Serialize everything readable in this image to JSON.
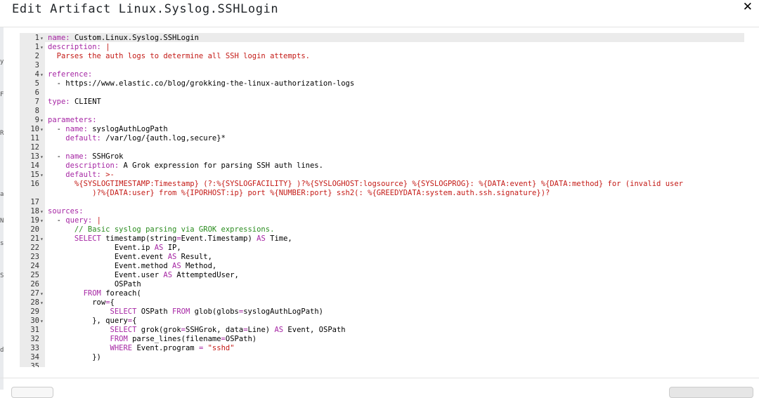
{
  "dialog": {
    "title": "Edit Artifact Linux.Syslog.SSHLogin",
    "close_icon": "✕"
  },
  "background_edge": [
    "y",
    "F",
    "R",
    "a",
    "N",
    "s",
    "S",
    "d"
  ],
  "editor": {
    "lines": [
      {
        "n": "1",
        "fold": "▾",
        "t": [
          [
            "k",
            "name: "
          ],
          [
            "p",
            "Custom.Linux.Syslog.SSHLogin"
          ]
        ]
      },
      {
        "n": "1",
        "fold": "▾",
        "t": [
          [
            "k",
            "description: "
          ],
          [
            "s",
            "|"
          ]
        ]
      },
      {
        "n": "2",
        "fold": "",
        "t": [
          [
            "s",
            "  Parses the auth logs to determine all SSH login attempts."
          ]
        ]
      },
      {
        "n": "3",
        "fold": "",
        "t": []
      },
      {
        "n": "4",
        "fold": "▾",
        "t": [
          [
            "k",
            "reference:"
          ]
        ]
      },
      {
        "n": "5",
        "fold": "",
        "t": [
          [
            "p",
            "  - https://www.elastic.co/blog/grokking-the-linux-authorization-logs"
          ]
        ]
      },
      {
        "n": "6",
        "fold": "",
        "t": []
      },
      {
        "n": "7",
        "fold": "",
        "t": [
          [
            "k",
            "type: "
          ],
          [
            "p",
            "CLIENT"
          ]
        ]
      },
      {
        "n": "8",
        "fold": "",
        "t": []
      },
      {
        "n": "9",
        "fold": "▾",
        "t": [
          [
            "k",
            "parameters:"
          ]
        ]
      },
      {
        "n": "10",
        "fold": "▾",
        "t": [
          [
            "p",
            "  - "
          ],
          [
            "k",
            "name: "
          ],
          [
            "p",
            "syslogAuthLogPath"
          ]
        ]
      },
      {
        "n": "11",
        "fold": "",
        "t": [
          [
            "p",
            "    "
          ],
          [
            "k",
            "default: "
          ],
          [
            "p",
            "/var/log/{auth.log,secure}*"
          ]
        ]
      },
      {
        "n": "12",
        "fold": "",
        "t": []
      },
      {
        "n": "13",
        "fold": "▾",
        "t": [
          [
            "p",
            "  - "
          ],
          [
            "k",
            "name: "
          ],
          [
            "p",
            "SSHGrok"
          ]
        ]
      },
      {
        "n": "14",
        "fold": "",
        "t": [
          [
            "p",
            "    "
          ],
          [
            "k",
            "description: "
          ],
          [
            "p",
            "A Grok expression for parsing SSH auth lines."
          ]
        ]
      },
      {
        "n": "15",
        "fold": "▾",
        "t": [
          [
            "p",
            "    "
          ],
          [
            "k",
            "default: "
          ],
          [
            "s",
            ">-"
          ]
        ]
      },
      {
        "n": "16",
        "fold": "",
        "t": [
          [
            "s",
            "      %{SYSLOGTIMESTAMP:Timestamp} (?:%{SYSLOGFACILITY} )?%{SYSLOGHOST:logsource} %{SYSLOGPROG}: %{DATA:event} %{DATA:method} for (invalid user"
          ]
        ]
      },
      {
        "n": "",
        "fold": "",
        "t": [
          [
            "s",
            "          )?%{DATA:user} from %{IPORHOST:ip} port %{NUMBER:port} ssh2(: %{GREEDYDATA:system.auth.ssh.signature})?"
          ]
        ]
      },
      {
        "n": "17",
        "fold": "",
        "t": []
      },
      {
        "n": "18",
        "fold": "▾",
        "t": [
          [
            "k",
            "sources:"
          ]
        ]
      },
      {
        "n": "19",
        "fold": "▾",
        "t": [
          [
            "p",
            "  - "
          ],
          [
            "k",
            "query: "
          ],
          [
            "s",
            "|"
          ]
        ]
      },
      {
        "n": "20",
        "fold": "",
        "t": [
          [
            "c",
            "      // Basic syslog parsing via GROK expressions."
          ]
        ]
      },
      {
        "n": "21",
        "fold": "▾",
        "t": [
          [
            "w",
            "      SELECT "
          ],
          [
            "p",
            "timestamp(string"
          ],
          [
            "w",
            "="
          ],
          [
            "p",
            "Event.Timestamp) "
          ],
          [
            "w",
            "AS"
          ],
          [
            "p",
            " Time,"
          ]
        ]
      },
      {
        "n": "22",
        "fold": "",
        "t": [
          [
            "p",
            "               Event.ip "
          ],
          [
            "w",
            "AS"
          ],
          [
            "p",
            " IP,"
          ]
        ]
      },
      {
        "n": "23",
        "fold": "",
        "t": [
          [
            "p",
            "               Event.event "
          ],
          [
            "w",
            "AS"
          ],
          [
            "p",
            " Result,"
          ]
        ]
      },
      {
        "n": "24",
        "fold": "",
        "t": [
          [
            "p",
            "               Event.method "
          ],
          [
            "w",
            "AS"
          ],
          [
            "p",
            " Method,"
          ]
        ]
      },
      {
        "n": "25",
        "fold": "",
        "t": [
          [
            "p",
            "               Event.user "
          ],
          [
            "w",
            "AS"
          ],
          [
            "p",
            " AttemptedUser,"
          ]
        ]
      },
      {
        "n": "26",
        "fold": "",
        "t": [
          [
            "p",
            "               OSPath"
          ]
        ]
      },
      {
        "n": "27",
        "fold": "▾",
        "t": [
          [
            "w",
            "        FROM "
          ],
          [
            "p",
            "foreach("
          ]
        ]
      },
      {
        "n": "28",
        "fold": "▾",
        "t": [
          [
            "p",
            "          row"
          ],
          [
            "w",
            "="
          ],
          [
            "p",
            "{"
          ]
        ]
      },
      {
        "n": "29",
        "fold": "",
        "t": [
          [
            "w",
            "              SELECT "
          ],
          [
            "p",
            "OSPath "
          ],
          [
            "w",
            "FROM "
          ],
          [
            "p",
            "glob(globs"
          ],
          [
            "w",
            "="
          ],
          [
            "p",
            "syslogAuthLogPath)"
          ]
        ]
      },
      {
        "n": "30",
        "fold": "▾",
        "t": [
          [
            "p",
            "          }, query"
          ],
          [
            "w",
            "="
          ],
          [
            "p",
            "{"
          ]
        ]
      },
      {
        "n": "31",
        "fold": "",
        "t": [
          [
            "w",
            "              SELECT "
          ],
          [
            "p",
            "grok(grok"
          ],
          [
            "w",
            "="
          ],
          [
            "p",
            "SSHGrok, data"
          ],
          [
            "w",
            "="
          ],
          [
            "p",
            "Line) "
          ],
          [
            "w",
            "AS"
          ],
          [
            "p",
            " Event, OSPath"
          ]
        ]
      },
      {
        "n": "32",
        "fold": "",
        "t": [
          [
            "w",
            "              FROM "
          ],
          [
            "p",
            "parse_lines(filename"
          ],
          [
            "w",
            "="
          ],
          [
            "p",
            "OSPath)"
          ]
        ]
      },
      {
        "n": "33",
        "fold": "",
        "t": [
          [
            "w",
            "              WHERE "
          ],
          [
            "p",
            "Event.program "
          ],
          [
            "w",
            "= "
          ],
          [
            "s",
            "\"sshd\""
          ]
        ]
      },
      {
        "n": "34",
        "fold": "",
        "t": [
          [
            "p",
            "          })"
          ]
        ]
      },
      {
        "n": "35",
        "fold": "",
        "t": []
      }
    ]
  }
}
